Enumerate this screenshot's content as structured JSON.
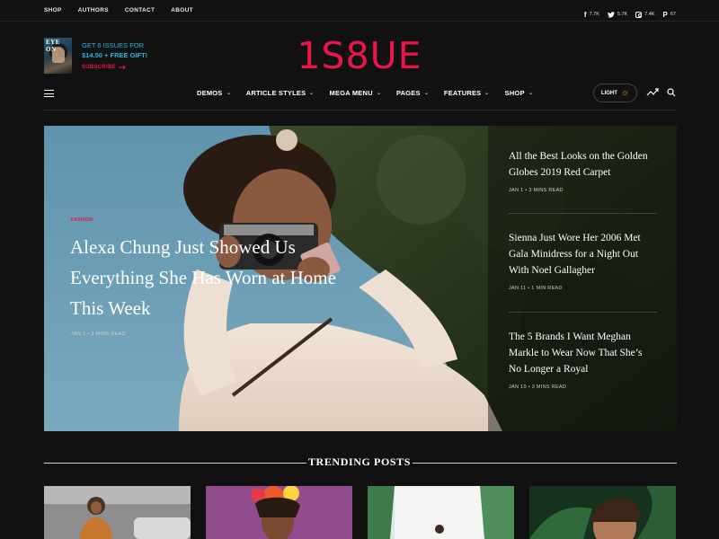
{
  "topbar": {
    "links": [
      "SHOP",
      "AUTHORS",
      "CONTACT",
      "ABOUT"
    ],
    "social": [
      {
        "icon": "facebook-icon",
        "glyph": "f",
        "count": "7.7K"
      },
      {
        "icon": "twitter-icon",
        "glyph": "t",
        "count": "5.7K"
      },
      {
        "icon": "instagram-icon",
        "glyph": "",
        "count": "7.4K"
      },
      {
        "icon": "pinterest-icon",
        "glyph": "P",
        "count": "67"
      }
    ]
  },
  "header": {
    "magazine_cover_title": "EYE ON",
    "promo_line1": "GET 6 ISSUES FOR",
    "promo_line2": "$14.50 + FREE GIFT!",
    "subscribe_label": "SUBSCRIBE",
    "logo": "1S8UE"
  },
  "nav": {
    "items": [
      "DEMOS",
      "ARTICLE STYLES",
      "MEGA MENU",
      "PAGES",
      "FEATURES",
      "SHOP"
    ],
    "light_label": "LIGHT"
  },
  "hero": {
    "tag": "FASHION",
    "title": "Alexa Chung Just Showed Us Everything She Has Worn at Home This Week",
    "meta": "JAN 1  •  3 MINS READ"
  },
  "side_posts": [
    {
      "title": "All the Best Looks on the Golden Globes 2019 Red Carpet",
      "meta": "JAN 1  •  3 MINS READ"
    },
    {
      "title": "Sienna Just Wore Her 2006 Met Gala Minidress for a Night Out With Noel Gallagher",
      "meta": "JAN 11  •  1 MIN READ"
    },
    {
      "title": "The 5 Brands I Want Meghan Markle to Wear Now That She’s No Longer a Royal",
      "meta": "JAN 10  •  3 MINS READ"
    }
  ],
  "trending": {
    "title": "TRENDING POSTS"
  },
  "colors": {
    "accent": "#e8174a",
    "promo": "#2bb7e0",
    "background": "#111111"
  }
}
